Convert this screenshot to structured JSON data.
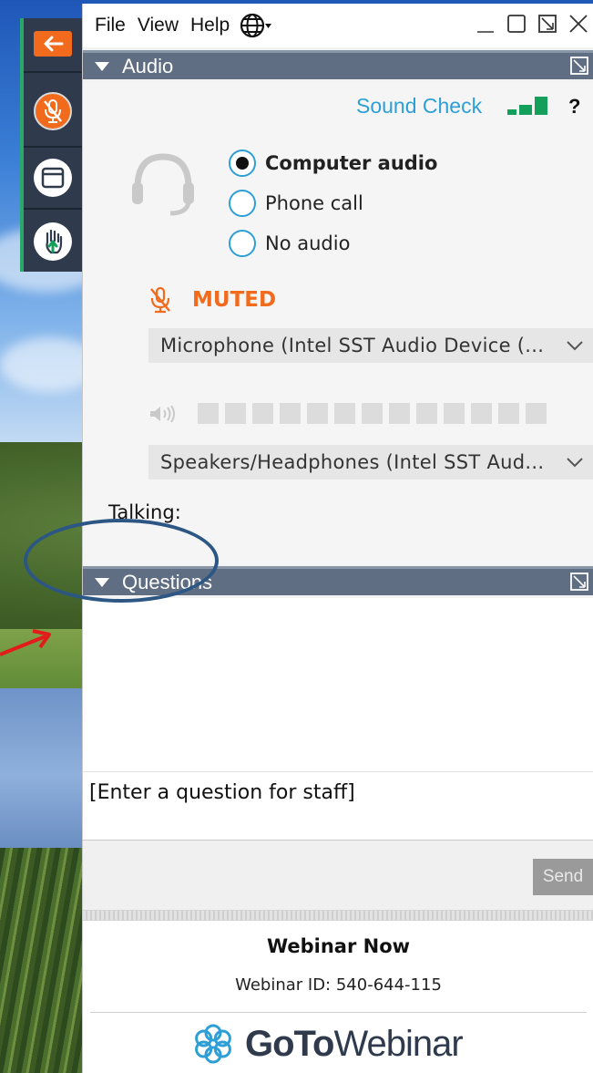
{
  "menu": {
    "file": "File",
    "view": "View",
    "help": "Help"
  },
  "icons": {
    "globe": "globe-icon",
    "minimize": "minimize-icon",
    "maximize": "maximize-icon",
    "restore": "restore-icon",
    "close": "close-icon"
  },
  "toolbar": {
    "items": [
      "back-arrow-icon",
      "microphone-muted-icon",
      "screen-icon",
      "raise-hand-icon"
    ],
    "accent": "#f26a1b"
  },
  "audio": {
    "header": "Audio",
    "sound_check": "Sound Check",
    "help": "?",
    "options": [
      {
        "label": "Computer audio",
        "selected": true
      },
      {
        "label": "Phone call",
        "selected": false
      },
      {
        "label": "No audio",
        "selected": false
      }
    ],
    "status": "MUTED",
    "microphone": "Microphone (Intel SST Audio Device (...",
    "speakers": "Speakers/Headphones (Intel SST Aud...",
    "talking_label": "Talking:"
  },
  "questions": {
    "header": "Questions",
    "input_placeholder": "[Enter a question for staff]",
    "send_label": "Send"
  },
  "footer": {
    "webinar_title": "Webinar Now",
    "webinar_id": "Webinar ID: 540-644-115",
    "brand_bold": "GoTo",
    "brand_light": "Webinar"
  },
  "colors": {
    "accent_orange": "#f26a1b",
    "link_blue": "#2e9fd6",
    "signal_green": "#14a05a",
    "header_gray": "#5f6e82"
  }
}
